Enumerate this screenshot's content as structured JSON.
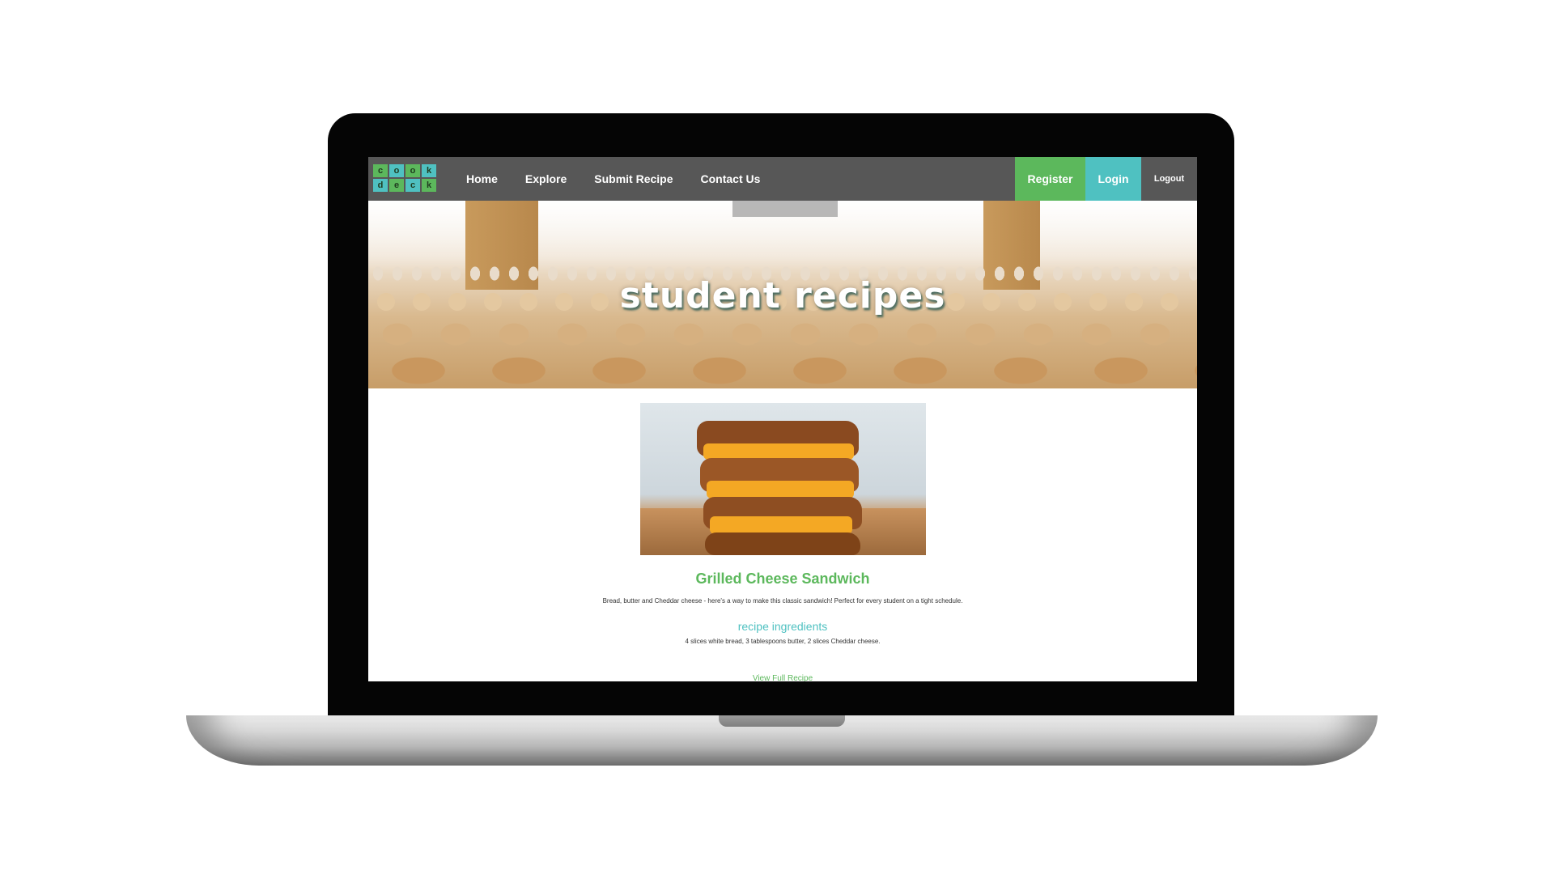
{
  "logo": {
    "letters": [
      "c",
      "o",
      "o",
      "k",
      "d",
      "e",
      "c",
      "k"
    ]
  },
  "nav": {
    "links": [
      "Home",
      "Explore",
      "Submit Recipe",
      "Contact Us"
    ],
    "register": "Register",
    "login": "Login",
    "logout": "Logout"
  },
  "hero": {
    "title": "student recipes"
  },
  "recipe": {
    "title": "Grilled Cheese Sandwich",
    "description": "Bread, butter and Cheddar cheese - here's a way to make this classic sandwich! Perfect for every student on a tight schedule.",
    "ingredients_heading": "recipe ingredients",
    "ingredients": "4 slices white bread, 3 tablespoons butter, 2 slices Cheddar cheese.",
    "link": "View Full Recipe"
  },
  "colors": {
    "nav_bg": "#575757",
    "green": "#5cb85c",
    "teal": "#4fc1c1",
    "laptop_bezel": "#050505"
  }
}
